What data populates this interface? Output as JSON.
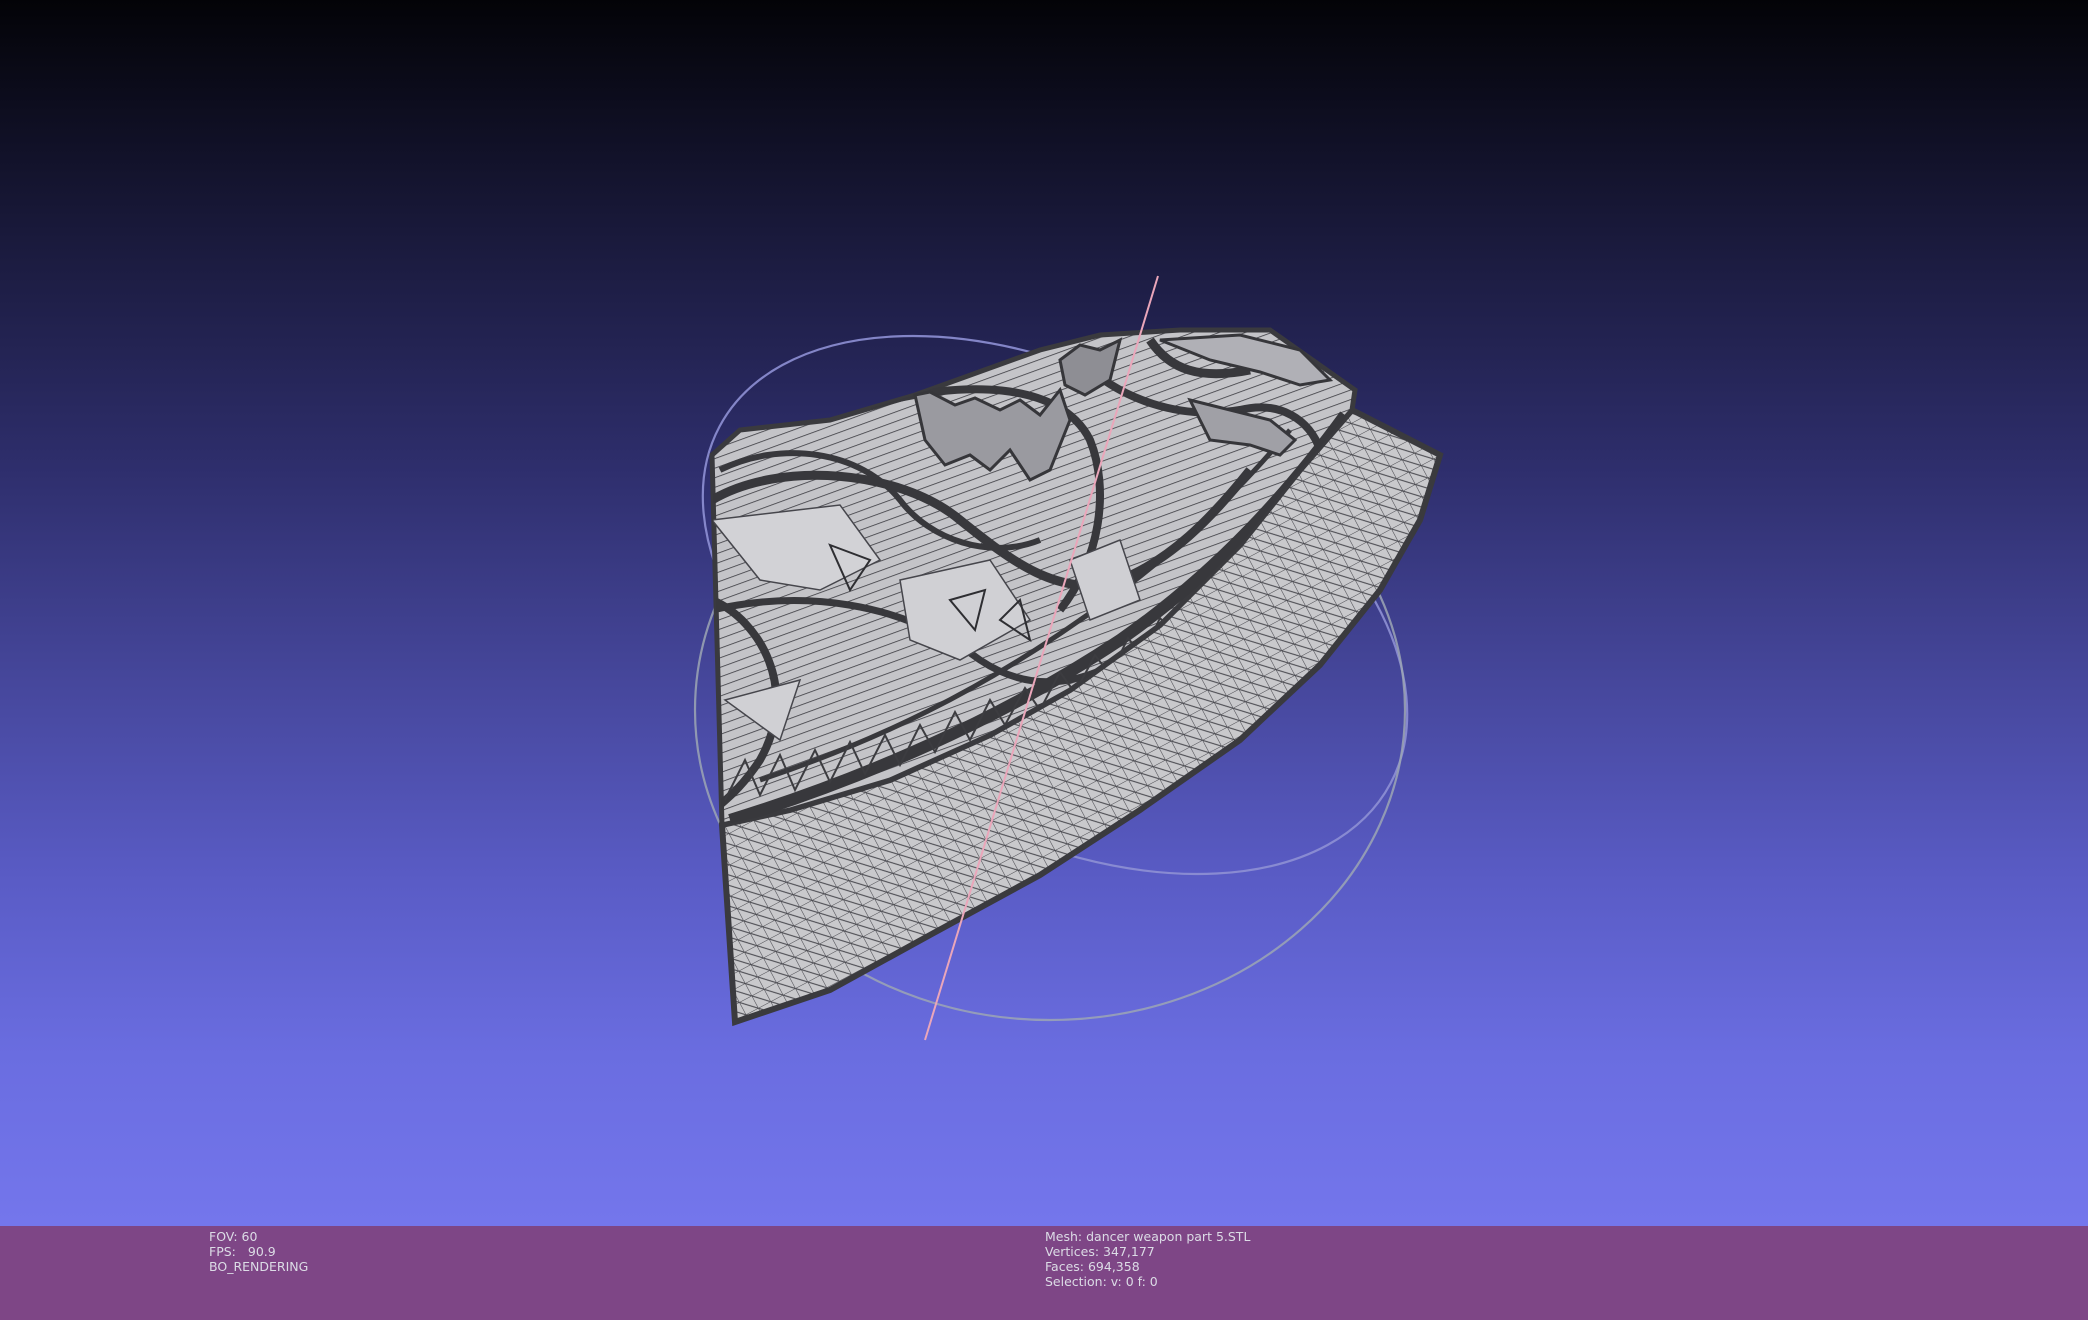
{
  "viewport": {
    "colors": {
      "background_top": "#030307",
      "background_bottom": "#7476ec",
      "mesh_fill": "#c6c6c8",
      "mesh_wire": "#3c3c40",
      "trackball_x": "#9a9ad8",
      "trackball_y": "#9aa6b6",
      "axis_line": "#e6a4b6"
    }
  },
  "info_bar": {
    "color": "#7e4686",
    "left": {
      "fov": "FOV: 60",
      "fps_label": "FPS:",
      "fps_value": "90.9",
      "render_mode": "BO_RENDERING"
    },
    "right": {
      "mesh": "Mesh: dancer weapon part 5.STL",
      "vertices": "Vertices: 347,177",
      "faces": "Faces: 694,358",
      "selection": "Selection: v: 0 f: 0"
    }
  }
}
